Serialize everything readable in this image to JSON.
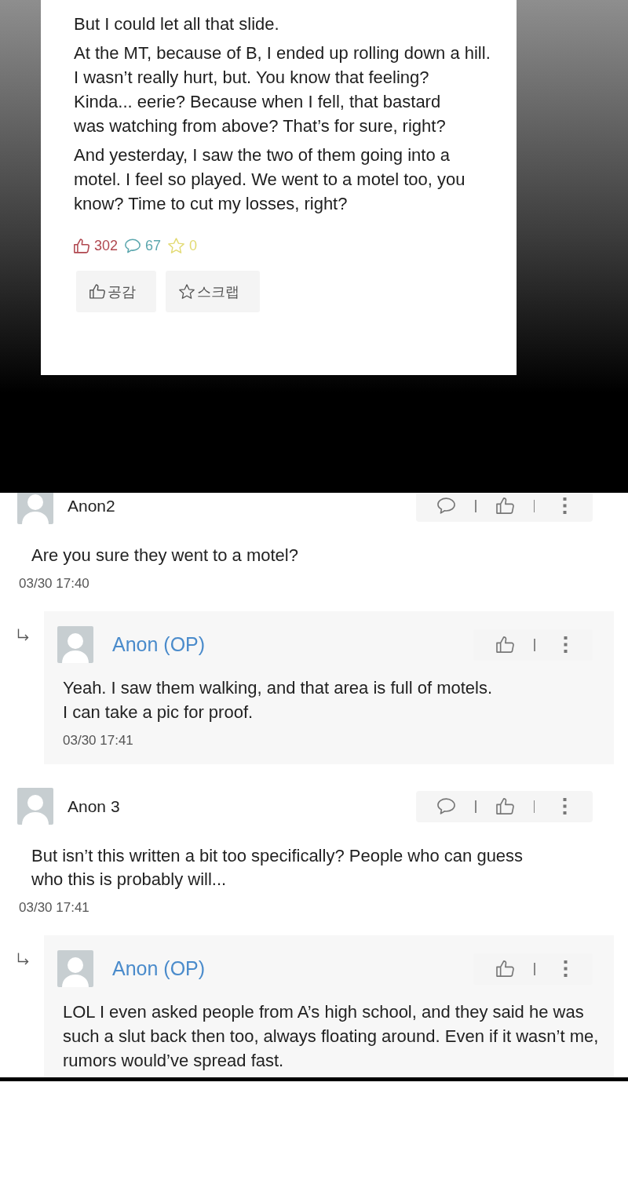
{
  "post": {
    "paragraphs": [
      "But I could let all that slide.",
      "At the MT, because of B, I ended up rolling down a hill.\nI wasn’t really hurt, but. You know that feeling?\nKinda... eerie? Because when I fell, that bastard\nwas watching from above? That’s for sure, right?",
      "And yesterday, I saw the two of them going into a\nmotel. I feel so played. We went to a motel too, you\nknow? Time to cut my losses, right?"
    ],
    "stats": [
      {
        "kind": "likes",
        "count": "302",
        "color": "#b0474f"
      },
      {
        "kind": "comments",
        "count": "67",
        "color": "#5aa6ad"
      },
      {
        "kind": "scraps",
        "count": "0",
        "color": "#e2da72"
      }
    ],
    "buttons": [
      {
        "kind": "like",
        "label": "공감"
      },
      {
        "kind": "scrap",
        "label": "스크랩"
      }
    ]
  },
  "comments": [
    {
      "author": "Anon2",
      "op": false,
      "text": "Are you sure they went to a motel?",
      "time": "03/30 17:40",
      "replies": [
        {
          "author": "Anon (OP)",
          "op": true,
          "text": "Yeah. I saw them walking, and that area is full of motels.\nI can take a pic for proof.",
          "time": "03/30 17:41"
        }
      ]
    },
    {
      "author": "Anon 3",
      "op": false,
      "text": "But isn’t this written a bit too specifically? People who can guess\nwho this is probably will...",
      "time": "03/30 17:41",
      "replies": [
        {
          "author": "Anon (OP)",
          "op": true,
          "text": "LOL I even asked people from A’s high school, and they said he was\nsuch a slut back then too, always floating around. Even if it wasn’t me,\nrumors would’ve spread fast."
        }
      ]
    }
  ]
}
